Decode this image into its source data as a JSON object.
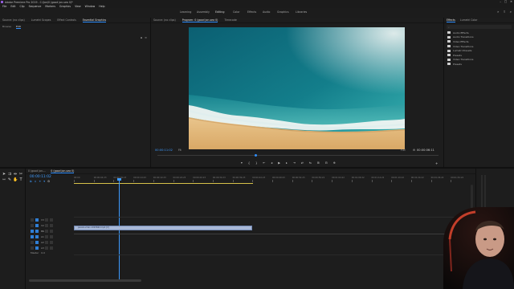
{
  "app": {
    "title": "Adobe Premiere Pro 2019 - C:\\Jon\\0 (good jon-sea 0)*",
    "window_controls": [
      "–",
      "□",
      "✕"
    ]
  },
  "menu": [
    "File",
    "Edit",
    "Clip",
    "Sequence",
    "Markers",
    "Graphics",
    "View",
    "Window",
    "Help"
  ],
  "workspaces": {
    "items": [
      "Learning",
      "Assembly",
      "Editing",
      "Color",
      "Effects",
      "Audio",
      "Graphics",
      "Libraries"
    ],
    "active_index": 2
  },
  "source_panel": {
    "tabs": [
      "Source: (no clips)",
      "Lumetri Scopes",
      "Effect Controls",
      "Essential Graphics"
    ],
    "active_tab": 3,
    "subtabs": [
      "Browse",
      "Edit"
    ],
    "active_subtab": 1
  },
  "program_panel": {
    "tabs": [
      "Source: (no clips)",
      "Program: 0 (good jon-sea 0)",
      "Timecode"
    ],
    "active_tab": 1,
    "timecode_current": "00:00:11:02",
    "fit_label": "Fit",
    "quality_label": "Full",
    "timecode_duration": "00:00:06:11",
    "playhead_fraction": 0.35,
    "controls": [
      "▾",
      "{",
      "}",
      "⇤",
      "◂",
      "▶",
      "▸",
      "⇥",
      "⇄",
      "⇆",
      "⊞",
      "⊟",
      "⌫",
      "⎘",
      "⊕"
    ]
  },
  "project_panel": {
    "tabs": [
      "Effects",
      "Lumetri Color"
    ],
    "active_tab": 0,
    "items": [
      "Audio Effects",
      "Audio Transitions",
      "Video Effects",
      "Video Transitions",
      "Lumetri Presets",
      "Presets",
      "Video Transitions",
      "Presets"
    ]
  },
  "timeline": {
    "tabs": [
      "0 (good jon-...",
      "0 (good jon-sea 0)"
    ],
    "active_tab": 1,
    "timecode": "00:00:11:02",
    "ruler_labels": [
      "00:00",
      "00:00:04:23",
      "00:00:09:23",
      "00:00:14:23",
      "00:00:19:23",
      "00:00:24:23",
      "00:00:29:23",
      "00:00:34:23",
      "00:00:39:23",
      "00:00:44:23",
      "00:00:49:23",
      "00:00:54:23",
      "00:00:59:22",
      "00:01:04:22",
      "00:01:09:22",
      "00:01:14:22",
      "00:01:19:22",
      "00:01:24:22",
      "00:01:29:22",
      "00:01:34:22"
    ],
    "tracks": [
      "V3",
      "V2",
      "V1",
      "A1",
      "A2",
      "A3",
      "Master"
    ],
    "clip_label": "pexels-video-1093662.mp4 [V]",
    "master_value": "0.0"
  },
  "colors": {
    "accent": "#2f8fff",
    "sea_deep": "#0f6e7c",
    "sea_shallow": "#2aa6b1",
    "sand": "#e7bd82",
    "clip": "#a8b8d6",
    "webcam_ring": "#e0472f"
  }
}
